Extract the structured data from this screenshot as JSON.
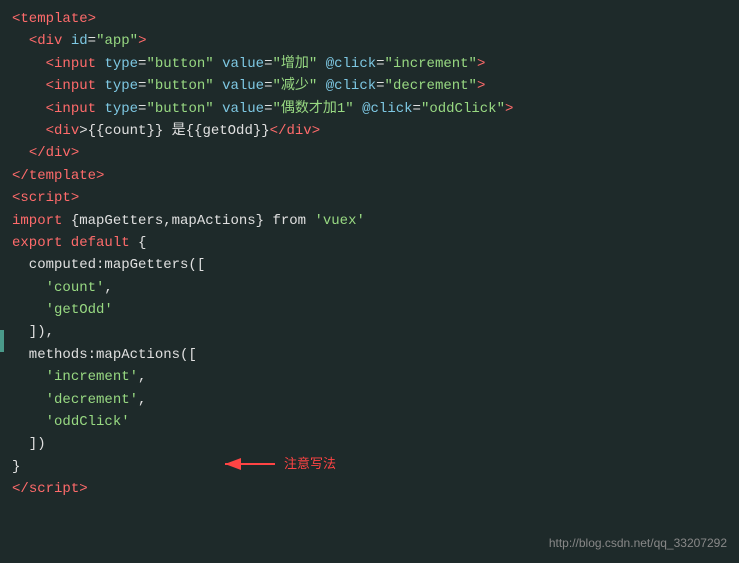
{
  "code": {
    "lines": [
      {
        "id": 1,
        "parts": [
          {
            "text": "<",
            "cls": "tag"
          },
          {
            "text": "template",
            "cls": "tag"
          },
          {
            "text": ">",
            "cls": "tag"
          }
        ]
      },
      {
        "id": 2,
        "parts": [
          {
            "text": "  ",
            "cls": "text-white"
          },
          {
            "text": "<",
            "cls": "tag"
          },
          {
            "text": "div",
            "cls": "tag"
          },
          {
            "text": " ",
            "cls": "text-white"
          },
          {
            "text": "id",
            "cls": "attr-name"
          },
          {
            "text": "=",
            "cls": "text-white"
          },
          {
            "text": "\"app\"",
            "cls": "attr-value"
          },
          {
            "text": ">",
            "cls": "tag"
          }
        ]
      },
      {
        "id": 3,
        "parts": [
          {
            "text": "    ",
            "cls": "text-white"
          },
          {
            "text": "<",
            "cls": "tag"
          },
          {
            "text": "input",
            "cls": "tag"
          },
          {
            "text": " ",
            "cls": "text-white"
          },
          {
            "text": "type",
            "cls": "attr-name"
          },
          {
            "text": "=",
            "cls": "text-white"
          },
          {
            "text": "\"button\"",
            "cls": "attr-value"
          },
          {
            "text": " ",
            "cls": "text-white"
          },
          {
            "text": "value",
            "cls": "attr-name"
          },
          {
            "text": "=",
            "cls": "text-white"
          },
          {
            "text": "\"增加\"",
            "cls": "attr-value"
          },
          {
            "text": " ",
            "cls": "text-white"
          },
          {
            "text": "@click",
            "cls": "attr-name"
          },
          {
            "text": "=",
            "cls": "text-white"
          },
          {
            "text": "\"increment\"",
            "cls": "attr-value"
          },
          {
            "text": ">",
            "cls": "tag"
          }
        ]
      },
      {
        "id": 4,
        "parts": [
          {
            "text": "    ",
            "cls": "text-white"
          },
          {
            "text": "<",
            "cls": "tag"
          },
          {
            "text": "input",
            "cls": "tag"
          },
          {
            "text": " ",
            "cls": "text-white"
          },
          {
            "text": "type",
            "cls": "attr-name"
          },
          {
            "text": "=",
            "cls": "text-white"
          },
          {
            "text": "\"button\"",
            "cls": "attr-value"
          },
          {
            "text": " ",
            "cls": "text-white"
          },
          {
            "text": "value",
            "cls": "attr-name"
          },
          {
            "text": "=",
            "cls": "text-white"
          },
          {
            "text": "\"减少\"",
            "cls": "attr-value"
          },
          {
            "text": " ",
            "cls": "text-white"
          },
          {
            "text": "@click",
            "cls": "attr-name"
          },
          {
            "text": "=",
            "cls": "text-white"
          },
          {
            "text": "\"decrement\"",
            "cls": "attr-value"
          },
          {
            "text": ">",
            "cls": "tag"
          }
        ]
      },
      {
        "id": 5,
        "parts": [
          {
            "text": "    ",
            "cls": "text-white"
          },
          {
            "text": "<",
            "cls": "tag"
          },
          {
            "text": "input",
            "cls": "tag"
          },
          {
            "text": " ",
            "cls": "text-white"
          },
          {
            "text": "type",
            "cls": "attr-name"
          },
          {
            "text": "=",
            "cls": "text-white"
          },
          {
            "text": "\"button\"",
            "cls": "attr-value"
          },
          {
            "text": " ",
            "cls": "text-white"
          },
          {
            "text": "value",
            "cls": "attr-name"
          },
          {
            "text": "=",
            "cls": "text-white"
          },
          {
            "text": "\"偶数才加1\"",
            "cls": "attr-value"
          },
          {
            "text": " ",
            "cls": "text-white"
          },
          {
            "text": "@click",
            "cls": "attr-name"
          },
          {
            "text": "=",
            "cls": "text-white"
          },
          {
            "text": "\"oddClick\"",
            "cls": "attr-value"
          },
          {
            "text": ">",
            "cls": "tag"
          }
        ]
      },
      {
        "id": 6,
        "parts": [
          {
            "text": "    ",
            "cls": "text-white"
          },
          {
            "text": "<",
            "cls": "tag"
          },
          {
            "text": "div",
            "cls": "tag"
          },
          {
            "text": ">{{count}} 是{{getOdd}}",
            "cls": "text-white"
          },
          {
            "text": "</",
            "cls": "tag"
          },
          {
            "text": "div",
            "cls": "tag"
          },
          {
            "text": ">",
            "cls": "tag"
          }
        ]
      },
      {
        "id": 7,
        "parts": [
          {
            "text": "  ",
            "cls": "text-white"
          },
          {
            "text": "</",
            "cls": "tag"
          },
          {
            "text": "div",
            "cls": "tag"
          },
          {
            "text": ">",
            "cls": "tag"
          }
        ]
      },
      {
        "id": 8,
        "parts": [
          {
            "text": "",
            "cls": "text-white"
          }
        ]
      },
      {
        "id": 9,
        "parts": [
          {
            "text": "</",
            "cls": "tag"
          },
          {
            "text": "template",
            "cls": "tag"
          },
          {
            "text": ">",
            "cls": "tag"
          }
        ]
      },
      {
        "id": 10,
        "parts": [
          {
            "text": "",
            "cls": "text-white"
          }
        ]
      },
      {
        "id": 11,
        "parts": [
          {
            "text": "<",
            "cls": "tag"
          },
          {
            "text": "script",
            "cls": "tag"
          },
          {
            "text": ">",
            "cls": "tag"
          }
        ]
      },
      {
        "id": 12,
        "parts": [
          {
            "text": "import ",
            "cls": "keyword"
          },
          {
            "text": "{mapGetters,mapActions}",
            "cls": "text-white"
          },
          {
            "text": " from ",
            "cls": "text-white"
          },
          {
            "text": "'vuex'",
            "cls": "string"
          }
        ]
      },
      {
        "id": 13,
        "parts": [
          {
            "text": "export default ",
            "cls": "keyword"
          },
          {
            "text": "{",
            "cls": "brace"
          }
        ]
      },
      {
        "id": 14,
        "parts": [
          {
            "text": "  computed:mapGetters([",
            "cls": "text-white"
          }
        ]
      },
      {
        "id": 15,
        "parts": [
          {
            "text": "    ",
            "cls": "text-white"
          },
          {
            "text": "'count'",
            "cls": "string"
          },
          {
            "text": ",",
            "cls": "text-white"
          }
        ]
      },
      {
        "id": 16,
        "parts": [
          {
            "text": "    ",
            "cls": "text-white"
          },
          {
            "text": "'getOdd'",
            "cls": "string"
          }
        ]
      },
      {
        "id": 17,
        "parts": [
          {
            "text": "  ]),",
            "cls": "text-white"
          }
        ]
      },
      {
        "id": 18,
        "parts": [
          {
            "text": "  methods:mapActions([",
            "cls": "text-white"
          }
        ]
      },
      {
        "id": 19,
        "parts": [
          {
            "text": "    ",
            "cls": "text-white"
          },
          {
            "text": "'increment'",
            "cls": "string"
          },
          {
            "text": ",",
            "cls": "text-white"
          }
        ]
      },
      {
        "id": 20,
        "parts": [
          {
            "text": "    ",
            "cls": "text-white"
          },
          {
            "text": "'decrement'",
            "cls": "string"
          },
          {
            "text": ",",
            "cls": "text-white"
          }
        ]
      },
      {
        "id": 21,
        "parts": [
          {
            "text": "    ",
            "cls": "text-white"
          },
          {
            "text": "'oddClick'",
            "cls": "string"
          }
        ]
      },
      {
        "id": 22,
        "parts": [
          {
            "text": "  ])",
            "cls": "text-white"
          }
        ]
      },
      {
        "id": 23,
        "parts": [
          {
            "text": "}",
            "cls": "brace"
          }
        ]
      },
      {
        "id": 24,
        "parts": [
          {
            "text": "</",
            "cls": "tag"
          },
          {
            "text": "script",
            "cls": "tag"
          },
          {
            "text": ">",
            "cls": "tag"
          }
        ]
      }
    ],
    "annotation": {
      "text": "注意写法",
      "color": "#ff4444"
    },
    "watermark": "http://blog.csdn.net/qq_33207292"
  }
}
